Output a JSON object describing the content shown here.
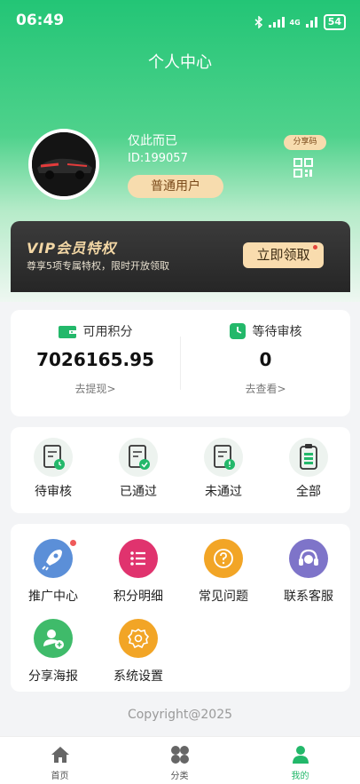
{
  "status_bar": {
    "time": "06:49",
    "signal1": "4G",
    "battery": "54"
  },
  "page": {
    "title": "个人中心"
  },
  "profile": {
    "username": "仅此而已",
    "user_id": "ID:199057",
    "level": "普通用户",
    "share_code_label": "分享码"
  },
  "vip": {
    "title": "VIP会员特权",
    "description": "尊享5项专属特权，限时开放领取",
    "button": "立即领取"
  },
  "points": {
    "available": {
      "label": "可用积分",
      "value": "7026165.95",
      "link": "去提现>"
    },
    "pending": {
      "label": "等待审核",
      "value": "0",
      "link": "去查看>"
    }
  },
  "review_status": [
    {
      "label": "待审核",
      "icon": "pending-doc-icon"
    },
    {
      "label": "已通过",
      "icon": "approved-doc-icon"
    },
    {
      "label": "未通过",
      "icon": "rejected-doc-icon"
    },
    {
      "label": "全部",
      "icon": "clipboard-icon"
    }
  ],
  "menu": [
    {
      "label": "推广中心",
      "icon": "rocket-icon",
      "color": "#5b8fd8",
      "badge": true
    },
    {
      "label": "积分明细",
      "icon": "list-icon",
      "color": "#e0336e"
    },
    {
      "label": "常见问题",
      "icon": "question-icon",
      "color": "#f2a526"
    },
    {
      "label": "联系客服",
      "icon": "headset-icon",
      "color": "#7e74c9"
    },
    {
      "label": "分享海报",
      "icon": "user-add-icon",
      "color": "#3fbb6a"
    },
    {
      "label": "系统设置",
      "icon": "gear-icon",
      "color": "#f2a526"
    }
  ],
  "footer": {
    "copyright": "Copyright@2025"
  },
  "tabbar": [
    {
      "label": "首页",
      "icon": "home-icon"
    },
    {
      "label": "分类",
      "icon": "category-icon"
    },
    {
      "label": "我的",
      "icon": "user-icon",
      "active": true
    }
  ],
  "colors": {
    "primary": "#23c576",
    "vip_gold": "#f3d7a5",
    "badge_red": "#ef5a5a"
  }
}
